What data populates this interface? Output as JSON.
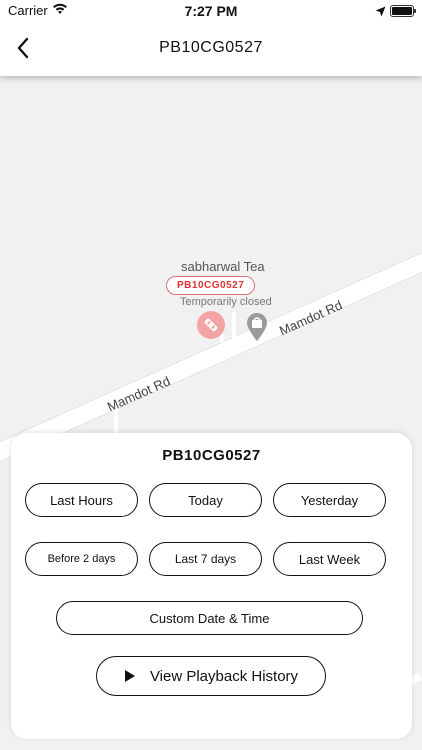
{
  "status_bar": {
    "carrier": "Carrier",
    "time": "7:27 PM"
  },
  "nav": {
    "title": "PB10CG0527"
  },
  "map": {
    "roads": [
      {
        "label": "Mamdot Rd"
      },
      {
        "label": "Mamdot Rd"
      }
    ],
    "place": {
      "name": "sabharwal Tea",
      "status": "Temporarily closed"
    },
    "vehicle_tag": "PB10CG0527"
  },
  "sheet": {
    "title": "PB10CG0527",
    "buttons": {
      "last_hours": "Last Hours",
      "today": "Today",
      "yesterday": "Yesterday",
      "before_2_days": "Before 2 days",
      "last_7_days": "Last 7 days",
      "last_week": "Last Week",
      "custom": "Custom Date & Time",
      "playback": "View Playback History"
    }
  },
  "colors": {
    "accent_red": "#d33333",
    "marker_pink": "#f3a5a5",
    "map_bg": "#f1f1f1",
    "road_white": "#ffffff"
  }
}
